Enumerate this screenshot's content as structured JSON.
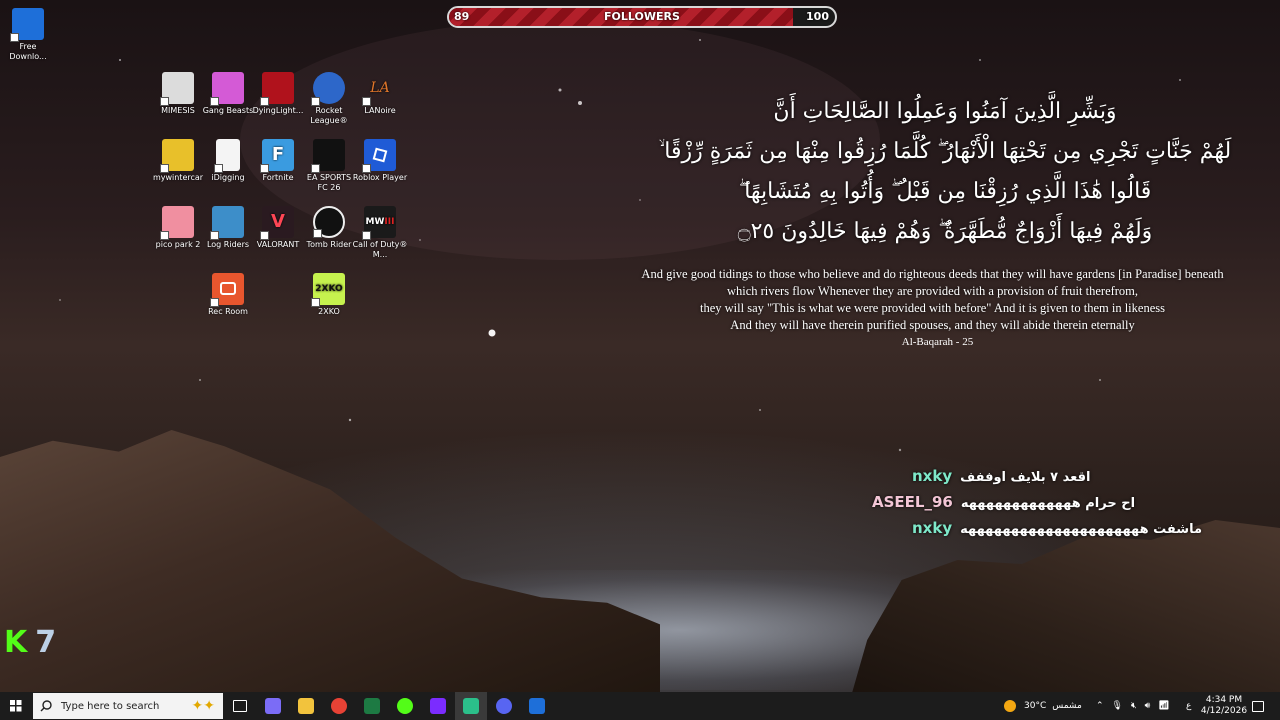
{
  "followers": {
    "current": "89",
    "label": "FOLLOWERS",
    "goal": "100",
    "progress": 0.89
  },
  "desktop_icons": [
    {
      "label": "Free Downlo...",
      "color": "#1e6fd9"
    },
    {
      "label": "MIMESIS",
      "color": "#d9d9d9"
    },
    {
      "label": "Gang Beasts",
      "color": "#d45ad6"
    },
    {
      "label": "DyingLight...",
      "color": "#b0121c"
    },
    {
      "label": "Rocket League®",
      "color": "#2d67c9"
    },
    {
      "label": "LANoire",
      "color": "#c9661b"
    },
    {
      "label": "mywintercar",
      "color": "#e8c02a"
    },
    {
      "label": "iDigging",
      "color": "#f4f4f4"
    },
    {
      "label": "Fortnite",
      "color": "#3a9be0"
    },
    {
      "label": "EA SPORTS FC 26",
      "color": "#111111"
    },
    {
      "label": "Roblox Player",
      "color": "#1f5bd6"
    },
    {
      "label": "pico park 2",
      "color": "#f08fa0"
    },
    {
      "label": "Log Riders",
      "color": "#3d8ec9"
    },
    {
      "label": "VALORANT",
      "color": "#2a1a20"
    },
    {
      "label": "Tomb Rider",
      "color": "#111111"
    },
    {
      "label": "Call of Duty® M...",
      "color": "#1a1a1a"
    },
    {
      "label": "Rec Room",
      "color": "#e8562e"
    },
    {
      "label": "2XKO",
      "color": "#c6f24e"
    }
  ],
  "verse": {
    "arabic": [
      "وَبَشِّرِ الَّذِينَ آمَنُوا وَعَمِلُوا الصَّالِحَاتِ أَنَّ",
      "لَهُمْ جَنَّاتٍ تَجْرِي مِن تَحْتِهَا الْأَنْهَارُ ۖ كُلَّمَا رُزِقُوا مِنْهَا مِن ثَمَرَةٍ رِّزْقًا ۙ",
      "قَالُوا هَٰذَا الَّذِي رُزِقْنَا مِن قَبْلُ ۖ وَأُتُوا بِهِ مُتَشَابِهًا ۖ",
      "وَلَهُمْ فِيهَا أَزْوَاجٌ مُّطَهَّرَةٌ ۖ وَهُمْ فِيهَا خَالِدُونَ ۝٢٥"
    ],
    "translation": [
      "And give good tidings to those who believe and do righteous deeds that they will have gardens [in Paradise] beneath",
      "which rivers flow Whenever they are provided with a provision of fruit therefrom,",
      "they will say \"This is what we were provided with before\" And it is given to them in likeness",
      "And they will have therein purified spouses, and they will abide therein eternally"
    ],
    "reference": "Al-Baqarah - 25"
  },
  "chat": [
    {
      "user": "nxky",
      "user_color": "#7ee8c9",
      "message": "اقعد ٧ بلايف اوففف"
    },
    {
      "user": "ASEEL_96",
      "user_color": "#f3c6d6",
      "message": "اح حرام هههههههههههههه"
    },
    {
      "user": "nxky",
      "user_color": "#7ee8c9",
      "message": "ماشفت هههههههههههههههههههههه"
    }
  ],
  "overlay": {
    "kick_letter": "K",
    "count": "7"
  },
  "taskbar": {
    "search_placeholder": "Type here to search",
    "weather_temp": "30°C",
    "weather_desc": "مشمس",
    "lang": "ع",
    "time": "4:34 PM",
    "date": "4/12/2026",
    "apps": [
      {
        "name": "task-view",
        "color": "#ffffff"
      },
      {
        "name": "copilot",
        "color": "#7b6cf6"
      },
      {
        "name": "file-explorer",
        "color": "#f2c33d"
      },
      {
        "name": "chrome",
        "color": "#e84235"
      },
      {
        "name": "excel",
        "color": "#1d7a43"
      },
      {
        "name": "kick",
        "color": "#53fc18"
      },
      {
        "name": "next",
        "color": "#7b2cff"
      },
      {
        "name": "app-green",
        "color": "#2bbf8a"
      },
      {
        "name": "discord",
        "color": "#5865f2"
      },
      {
        "name": "free-download-manager",
        "color": "#1e6fd9"
      }
    ]
  }
}
